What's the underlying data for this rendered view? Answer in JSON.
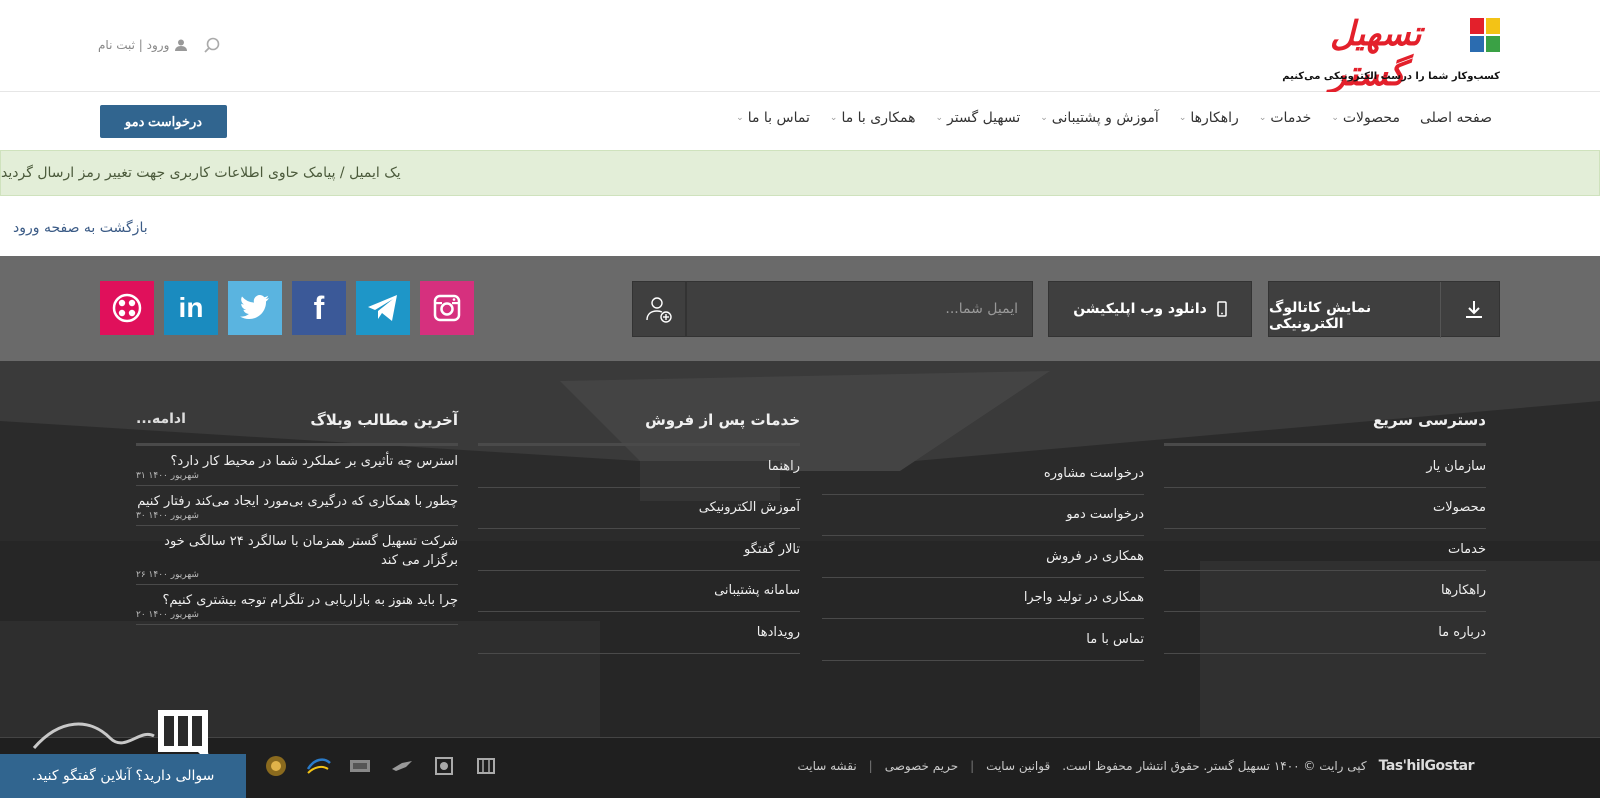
{
  "header": {
    "logo_text": "تسهیل گستر",
    "tagline": "کسب‌وکار شما را درست الکترونیکی می‌کنیم",
    "login_register": "ورود | ثبت نام"
  },
  "nav": {
    "items": [
      {
        "label": "صفحه اصلی",
        "has_dropdown": false
      },
      {
        "label": "محصولات",
        "has_dropdown": true
      },
      {
        "label": "خدمات",
        "has_dropdown": true
      },
      {
        "label": "راهکارها",
        "has_dropdown": true
      },
      {
        "label": "آموزش و پشتیبانی",
        "has_dropdown": true
      },
      {
        "label": "تسهیل گستر",
        "has_dropdown": true
      },
      {
        "label": "همکاری با ما",
        "has_dropdown": true
      },
      {
        "label": "تماس با ما",
        "has_dropdown": true
      }
    ],
    "demo_button": "درخواست دمو"
  },
  "alert": {
    "message": "یک ایمیل / پیامک حاوی اطلاعات کاربری جهت تغییر رمز ارسال گردید"
  },
  "back_link": "بازگشت به صفحه ورود",
  "strip": {
    "catalog_button": "نمایش کاتالوگ الکترونیکی",
    "app_button": "دانلود وب اپلیکیشن",
    "email_placeholder": "ایمیل شما...",
    "socials": [
      {
        "name": "instagram",
        "color": "#d6307e"
      },
      {
        "name": "telegram",
        "color": "#1e96c8"
      },
      {
        "name": "facebook",
        "color": "#3b5998"
      },
      {
        "name": "twitter",
        "color": "#5ab4e0"
      },
      {
        "name": "linkedin",
        "color": "#1a8bbf"
      },
      {
        "name": "aparat",
        "color": "#e0105b"
      }
    ]
  },
  "footer": {
    "quick_access": {
      "title": "دسترسی سریع",
      "items": [
        "سازمان یار",
        "محصولات",
        "خدمات",
        "راهکارها",
        "درباره ما"
      ]
    },
    "quick_access_2": {
      "items": [
        "درخواست مشاوره",
        "درخواست دمو",
        "همکاری در فروش",
        "همکاری در تولید واجرا",
        "تماس با ما"
      ]
    },
    "after_sales": {
      "title": "خدمات پس از فروش",
      "items": [
        "راهنما",
        "آموزش الکترونیکی",
        "تالار گفتگو",
        "سامانه پشتیبانی",
        "رویدادها"
      ]
    },
    "blog": {
      "title": "آخرین مطالب وبلاگ",
      "more": "ادامه...",
      "posts": [
        {
          "title": "استرس چه تأثیری بر عملکرد شما در محیط کار دارد؟",
          "date": "۳۱ شهریور ۱۴۰۰"
        },
        {
          "title": "چطور با همکاری که درگیری بی‌مورد ایجاد می‌کند رفتار کنیم",
          "date": "۳۰ شهریور ۱۴۰۰"
        },
        {
          "title": "شرکت تسهیل گستر همزمان با سالگرد ۲۴ سالگی خود برگزار می کند",
          "date": "۲۶ شهریور ۱۴۰۰"
        },
        {
          "title": "چرا باید هنوز به بازاریابی در تلگرام توجه بیشتری کنیم؟",
          "date": "۲۰ شهریور ۱۴۰۰"
        }
      ]
    }
  },
  "bottombar": {
    "brand": "Tas'hilGostar",
    "copyright": "کپی رایت © ۱۴۰۰ تسهیل گستر. حقوق انتشار محفوظ است.",
    "links": [
      "قوانین سایت",
      "حریم خصوصی",
      "نقشه سایت"
    ]
  },
  "chat": {
    "label": "سوالی دارید؟ آنلاین گفتگو کنید."
  }
}
